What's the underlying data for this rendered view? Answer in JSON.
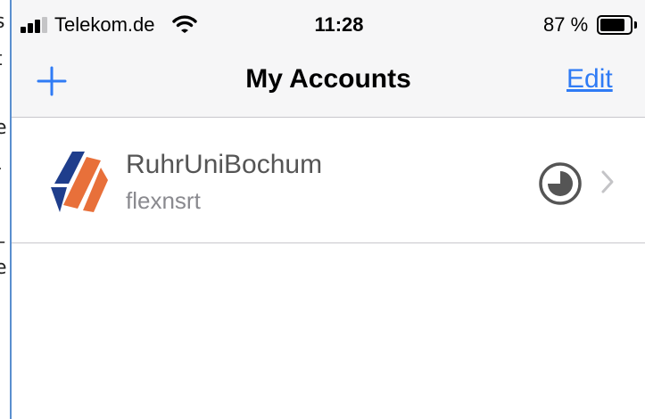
{
  "background_doc": {
    "fragments": [
      "s",
      "t",
      ".",
      "e",
      "-",
      "_",
      "e"
    ]
  },
  "status_bar": {
    "carrier": "Telekom.de",
    "time": "11:28",
    "battery_percent": "87 %",
    "battery_level": 0.87,
    "signal_bars": 3,
    "signal_bars_total": 4
  },
  "nav": {
    "title": "My Accounts",
    "add_icon": "plus-icon",
    "edit_label": "Edit"
  },
  "accounts": [
    {
      "name": "RuhrUniBochum",
      "username": "flexnsrt",
      "logo": "ruhr-uni-bochum-logo",
      "status_icon": "timer-icon",
      "chevron_icon": "chevron-right-icon"
    }
  ],
  "colors": {
    "accent": "#2F7BF5",
    "nav_background": "#F6F6F7",
    "separator": "#C8C7CC",
    "logo_blue": "#1F3E8C",
    "logo_orange": "#E8703A",
    "frame_line": "#5A8FCF"
  }
}
